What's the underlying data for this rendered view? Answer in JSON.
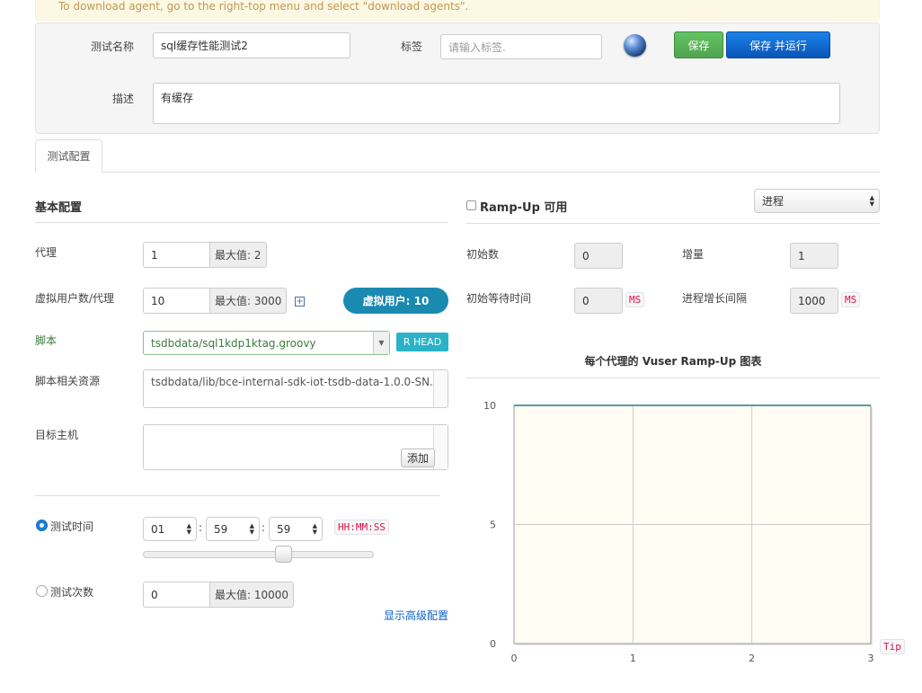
{
  "alert": {
    "text": "To download agent, go to the right-top menu and select \"download agents\"."
  },
  "header": {
    "name_label": "测试名称",
    "name_value": "sql缓存性能测试2",
    "tag_label": "标签",
    "tag_placeholder": "请输入标签.",
    "save_label": "保存",
    "save_run_label": "保存 并运行",
    "desc_label": "描述",
    "desc_value": "有缓存"
  },
  "tabs": {
    "config": "测试配置"
  },
  "basic": {
    "title": "基本配置",
    "agent_label": "代理",
    "agent_value": "1",
    "agent_max": "最大值: 2",
    "vuser_label": "虚拟用户数/代理",
    "vuser_value": "10",
    "vuser_max": "最大值: 3000",
    "vuser_badge": "虚拟用户: 10",
    "script_label": "脚本",
    "script_value": "tsdbdata/sql1kdp1ktag.groovy",
    "script_rev": "R HEAD",
    "resource_label": "脚本相关资源",
    "resource_value": "tsdbdata/lib/bce-internal-sdk-iot-tsdb-data-1.0.0-SN...",
    "host_label": "目标主机",
    "host_add": "添加",
    "duration_label": "测试时间",
    "hours": "01",
    "minutes": "59",
    "seconds": "59",
    "time_format": "HH:MM:SS",
    "slider_fraction": 0.5,
    "runcount_label": "测试次数",
    "runcount_value": "0",
    "runcount_max": "最大值: 10000",
    "advanced_link": "显示高级配置"
  },
  "rampup": {
    "enable_label": "Ramp-Up 可用",
    "type_value": "进程",
    "initial_count_label": "初始数",
    "initial_count": "0",
    "increment_label": "增量",
    "increment": "1",
    "initial_sleep_label": "初始等待时间",
    "initial_sleep": "0",
    "ms1": "MS",
    "interval_label": "进程增长间隔",
    "interval": "1000",
    "ms2": "MS",
    "chart_title": "每个代理的 Vuser Ramp-Up 图表",
    "tip": "Tip"
  },
  "chart_data": {
    "type": "line",
    "title": "每个代理的 Vuser Ramp-Up 图表",
    "x": [
      0,
      1,
      2,
      3
    ],
    "xlim": [
      0,
      3
    ],
    "ylim": [
      0,
      10
    ],
    "x_ticks": [
      "0",
      "1",
      "2",
      "3"
    ],
    "y_ticks": [
      "0",
      "5",
      "10"
    ],
    "series": [
      {
        "values": [
          10,
          10,
          10,
          10
        ]
      }
    ],
    "grid": true,
    "colors": {
      "line": "#5a9ba8",
      "plot_bg": "#fffdf3"
    }
  },
  "colors": {
    "save": "#51a351",
    "save_run": "#0e62c7",
    "badge": "#1b8ab0",
    "rev": "#2ab3c6",
    "alert_bg": "#fcf8e3"
  }
}
